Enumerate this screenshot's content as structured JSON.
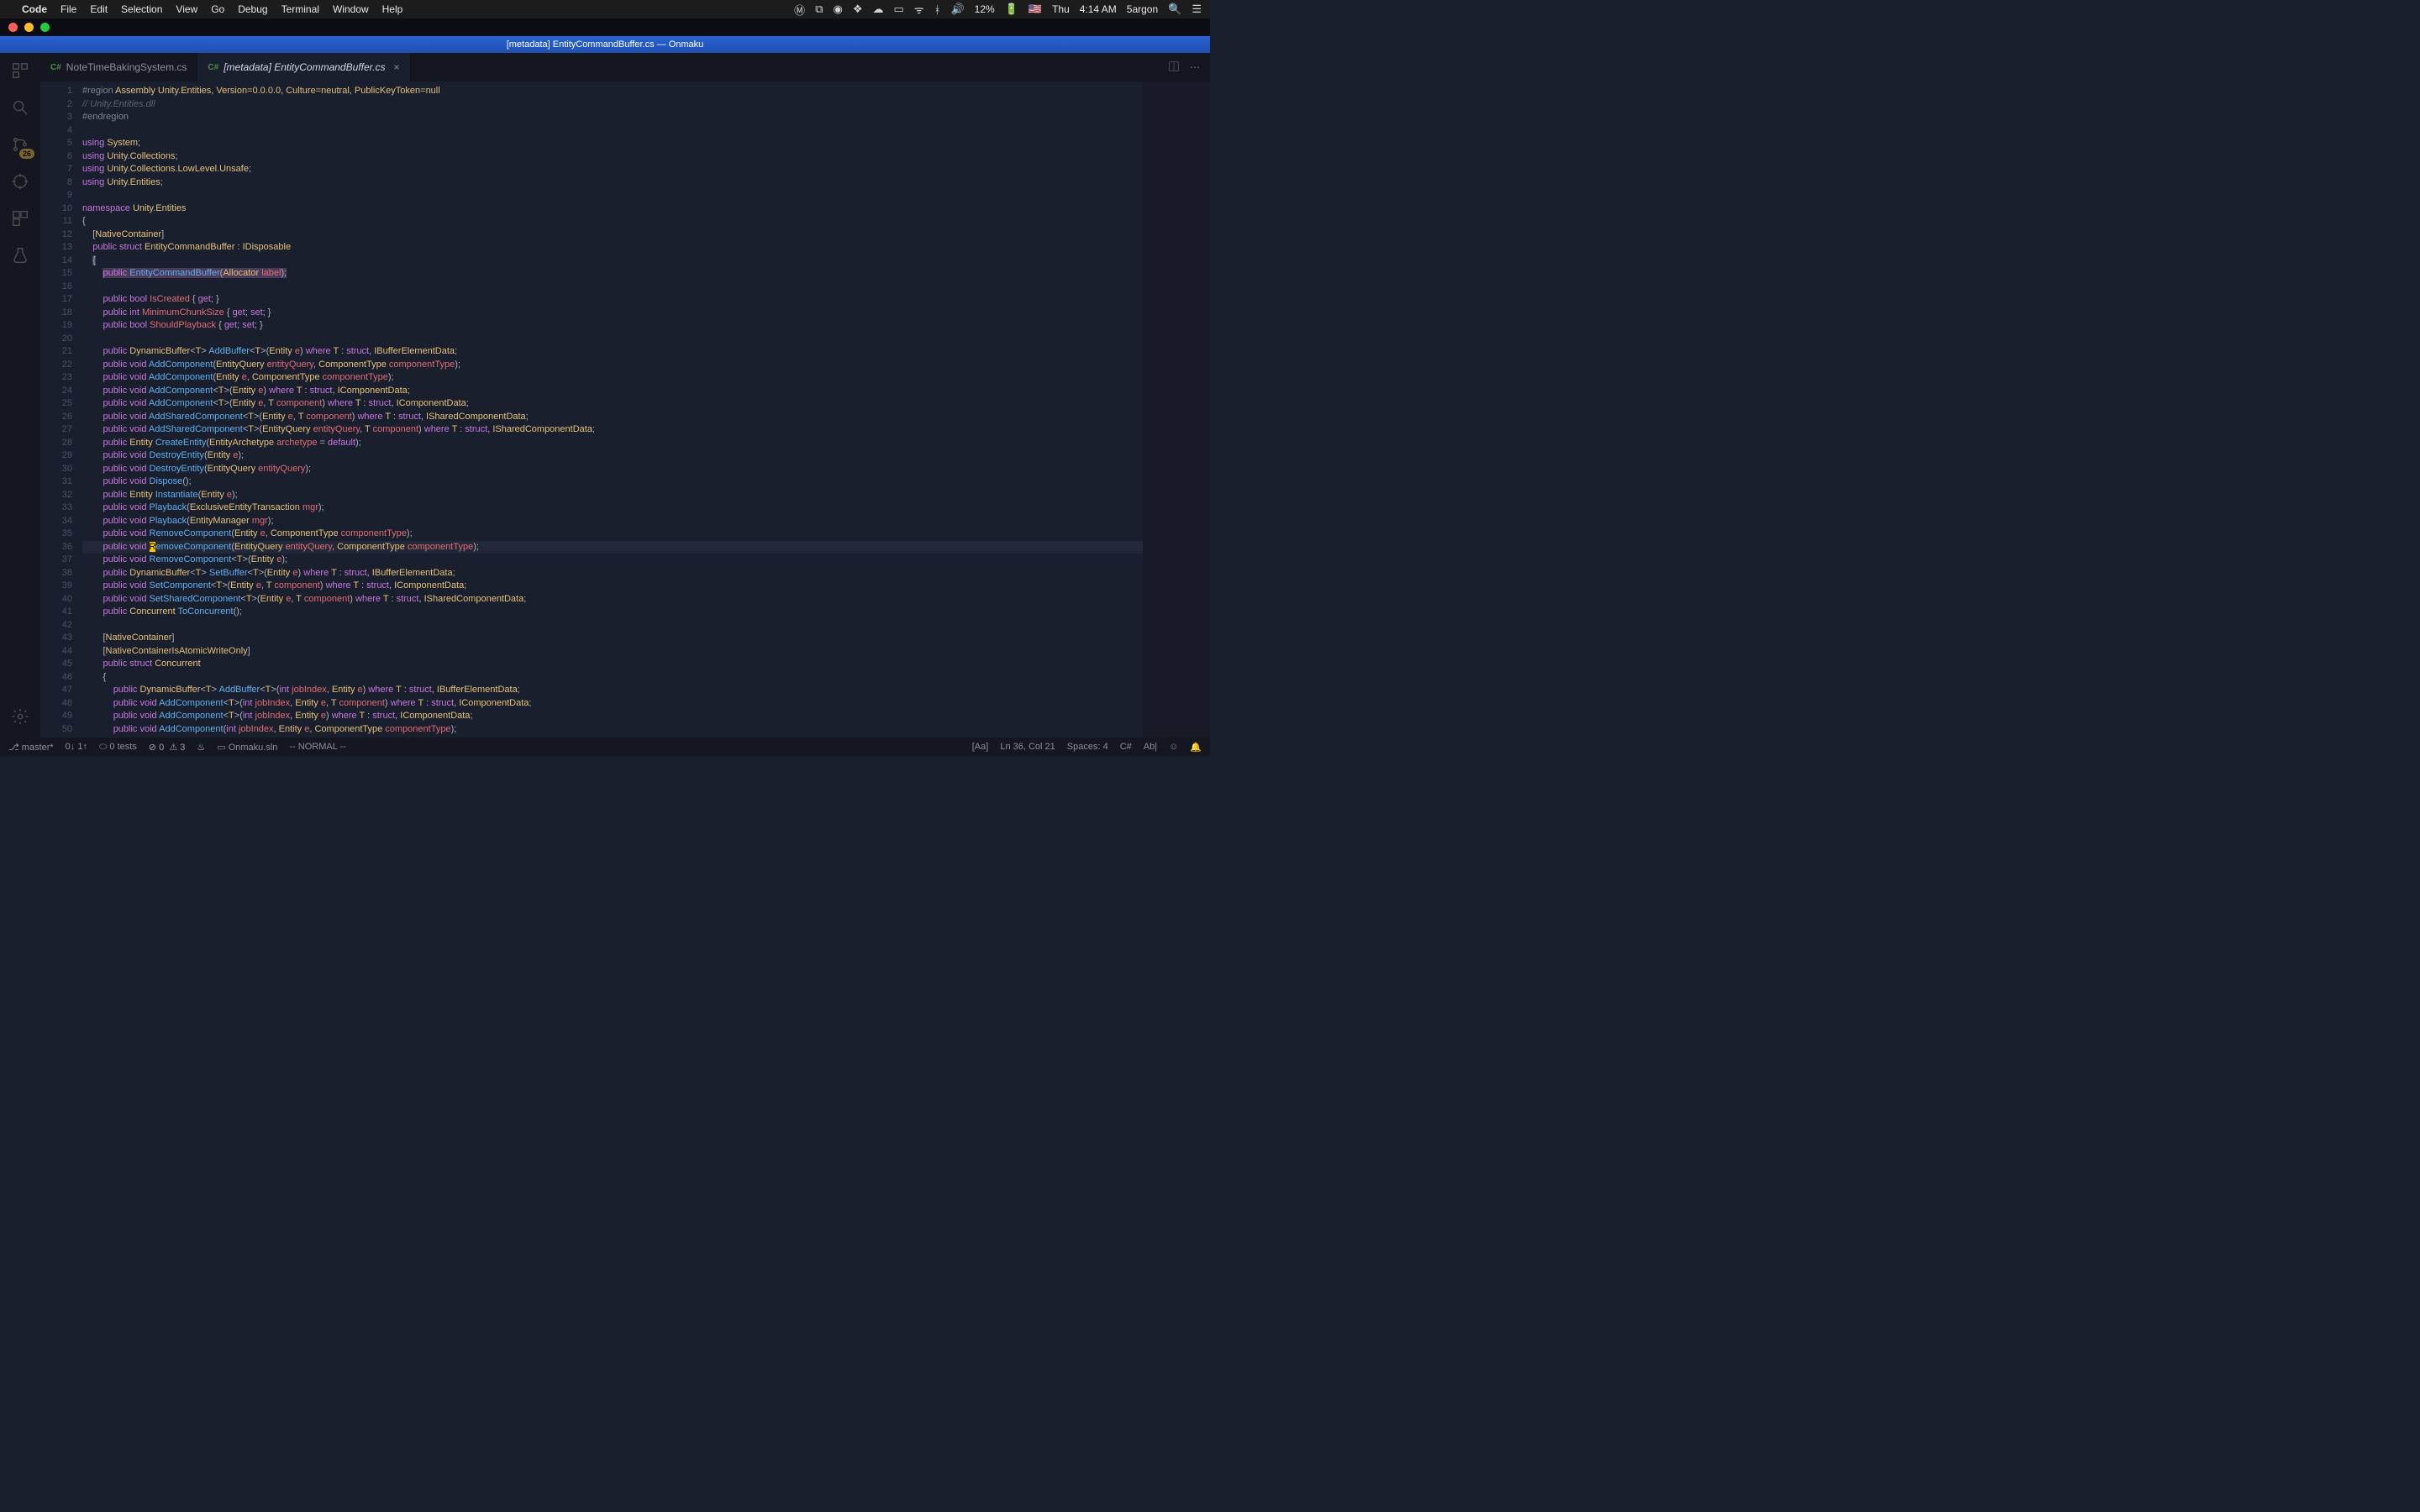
{
  "menubar": {
    "app": "Code",
    "items": [
      "File",
      "Edit",
      "Selection",
      "View",
      "Go",
      "Debug",
      "Terminal",
      "Window",
      "Help"
    ],
    "right": {
      "battery": "12%",
      "day": "Thu",
      "time": "4:14 AM",
      "user": "5argon"
    }
  },
  "window": {
    "title": "[metadata] EntityCommandBuffer.cs — Onmaku"
  },
  "activity": {
    "badge": "26"
  },
  "tabs": {
    "items": [
      {
        "icon": "C#",
        "label": "NoteTimeBakingSystem.cs",
        "active": false,
        "italic": false
      },
      {
        "icon": "C#",
        "label": "[metadata] EntityCommandBuffer.cs",
        "active": true,
        "italic": true
      }
    ]
  },
  "statusbar": {
    "branch": "master*",
    "sync": "0↓ 1↑",
    "tests": "0 tests",
    "errors": "0",
    "warnings": "3",
    "solution": "Onmaku.sln",
    "vim": "-- NORMAL --",
    "pos": "Ln 36, Col 21",
    "spaces": "Spaces: 4",
    "lang": "C#",
    "enc": "Ab|"
  },
  "code": {
    "lines": [
      {
        "n": 1,
        "html": "<span class='region'>#region</span> <span class='type'>Assembly Unity.Entities, Version=0.0.0.0, Culture=neutral, PublicKeyToken=null</span>"
      },
      {
        "n": 2,
        "html": "<span class='comment'>// Unity.Entities.dll</span>"
      },
      {
        "n": 3,
        "html": "<span class='region'>#endregion</span>"
      },
      {
        "n": 4,
        "html": ""
      },
      {
        "n": 5,
        "html": "<span class='kw'>using</span> <span class='type'>System</span>;"
      },
      {
        "n": 6,
        "html": "<span class='kw'>using</span> <span class='type'>Unity</span>.<span class='type'>Collections</span>;"
      },
      {
        "n": 7,
        "html": "<span class='kw'>using</span> <span class='type'>Unity</span>.<span class='type'>Collections</span>.<span class='type'>LowLevel</span>.<span class='type'>Unsafe</span>;"
      },
      {
        "n": 8,
        "html": "<span class='kw'>using</span> <span class='type'>Unity</span>.<span class='type'>Entities</span>;"
      },
      {
        "n": 9,
        "html": ""
      },
      {
        "n": 10,
        "html": "<span class='kw'>namespace</span> <span class='type'>Unity</span>.<span class='type'>Entities</span>"
      },
      {
        "n": 11,
        "html": "{"
      },
      {
        "n": 12,
        "html": "    [<span class='type'>NativeContainer</span>]"
      },
      {
        "n": 13,
        "html": "    <span class='kw'>public</span> <span class='kw'>struct</span> <span class='type'>EntityCommandBuffer</span> : <span class='type'>IDisposable</span>"
      },
      {
        "n": 14,
        "html": "    <span class='hl'>{</span>"
      },
      {
        "n": 15,
        "html": "        <span class='sel'><span class='kw'>public</span> <span class='method'>EntityCommandBuffer</span>(<span class='type'>Allocator</span> <span class='var'>label</span>);</span>"
      },
      {
        "n": 16,
        "html": ""
      },
      {
        "n": 17,
        "html": "        <span class='kw'>public</span> <span class='kw'>bool</span> <span class='var'>IsCreated</span> { <span class='kw'>get</span>; }"
      },
      {
        "n": 18,
        "html": "        <span class='kw'>public</span> <span class='kw'>int</span> <span class='var'>MinimumChunkSize</span> { <span class='kw'>get</span>; <span class='kw'>set</span>; }"
      },
      {
        "n": 19,
        "html": "        <span class='kw'>public</span> <span class='kw'>bool</span> <span class='var'>ShouldPlayback</span> { <span class='kw'>get</span>; <span class='kw'>set</span>; }"
      },
      {
        "n": 20,
        "html": ""
      },
      {
        "n": 21,
        "html": "        <span class='kw'>public</span> <span class='type'>DynamicBuffer</span>&lt;<span class='type'>T</span>&gt; <span class='method'>AddBuffer</span>&lt;<span class='type'>T</span>&gt;(<span class='type'>Entity</span> <span class='var'>e</span>) <span class='kw'>where</span> <span class='type'>T</span> : <span class='kw'>struct</span>, <span class='type'>IBufferElementData</span>;"
      },
      {
        "n": 22,
        "html": "        <span class='kw'>public</span> <span class='kw'>void</span> <span class='method'>AddComponent</span>(<span class='type'>EntityQuery</span> <span class='var'>entityQuery</span>, <span class='type'>ComponentType</span> <span class='var'>componentType</span>);"
      },
      {
        "n": 23,
        "html": "        <span class='kw'>public</span> <span class='kw'>void</span> <span class='method'>AddComponent</span>(<span class='type'>Entity</span> <span class='var'>e</span>, <span class='type'>ComponentType</span> <span class='var'>componentType</span>);"
      },
      {
        "n": 24,
        "html": "        <span class='kw'>public</span> <span class='kw'>void</span> <span class='method'>AddComponent</span>&lt;<span class='type'>T</span>&gt;(<span class='type'>Entity</span> <span class='var'>e</span>) <span class='kw'>where</span> <span class='type'>T</span> : <span class='kw'>struct</span>, <span class='type'>IComponentData</span>;"
      },
      {
        "n": 25,
        "html": "        <span class='kw'>public</span> <span class='kw'>void</span> <span class='method'>AddComponent</span>&lt;<span class='type'>T</span>&gt;(<span class='type'>Entity</span> <span class='var'>e</span>, <span class='type'>T</span> <span class='var'>component</span>) <span class='kw'>where</span> <span class='type'>T</span> : <span class='kw'>struct</span>, <span class='type'>IComponentData</span>;"
      },
      {
        "n": 26,
        "html": "        <span class='kw'>public</span> <span class='kw'>void</span> <span class='method'>AddSharedComponent</span>&lt;<span class='type'>T</span>&gt;(<span class='type'>Entity</span> <span class='var'>e</span>, <span class='type'>T</span> <span class='var'>component</span>) <span class='kw'>where</span> <span class='type'>T</span> : <span class='kw'>struct</span>, <span class='type'>ISharedComponentData</span>;"
      },
      {
        "n": 27,
        "html": "        <span class='kw'>public</span> <span class='kw'>void</span> <span class='method'>AddSharedComponent</span>&lt;<span class='type'>T</span>&gt;(<span class='type'>EntityQuery</span> <span class='var'>entityQuery</span>, <span class='type'>T</span> <span class='var'>component</span>) <span class='kw'>where</span> <span class='type'>T</span> : <span class='kw'>struct</span>, <span class='type'>ISharedComponentData</span>;"
      },
      {
        "n": 28,
        "html": "        <span class='kw'>public</span> <span class='type'>Entity</span> <span class='method'>CreateEntity</span>(<span class='type'>EntityArchetype</span> <span class='var'>archetype</span> = <span class='kw'>default</span>);"
      },
      {
        "n": 29,
        "html": "        <span class='kw'>public</span> <span class='kw'>void</span> <span class='method'>DestroyEntity</span>(<span class='type'>Entity</span> <span class='var'>e</span>);"
      },
      {
        "n": 30,
        "html": "        <span class='kw'>public</span> <span class='kw'>void</span> <span class='method'>DestroyEntity</span>(<span class='type'>EntityQuery</span> <span class='var'>entityQuery</span>);"
      },
      {
        "n": 31,
        "html": "        <span class='kw'>public</span> <span class='kw'>void</span> <span class='method'>Dispose</span>();"
      },
      {
        "n": 32,
        "html": "        <span class='kw'>public</span> <span class='type'>Entity</span> <span class='method'>Instantiate</span>(<span class='type'>Entity</span> <span class='var'>e</span>);"
      },
      {
        "n": 33,
        "html": "        <span class='kw'>public</span> <span class='kw'>void</span> <span class='method'>Playback</span>(<span class='type'>ExclusiveEntityTransaction</span> <span class='var'>mgr</span>);"
      },
      {
        "n": 34,
        "html": "        <span class='kw'>public</span> <span class='kw'>void</span> <span class='method'>Playback</span>(<span class='type'>EntityManager</span> <span class='var'>mgr</span>);"
      },
      {
        "n": 35,
        "html": "        <span class='kw'>public</span> <span class='kw'>void</span> <span class='method'>RemoveComponent</span>(<span class='type'>Entity</span> <span class='var'>e</span>, <span class='type'>ComponentType</span> <span class='var'>componentType</span>);"
      },
      {
        "n": 36,
        "current": true,
        "html": "        <span class='kw'>public</span> <span class='kw'>void</span> <span class='cursor'>R</span><span class='method'>emoveComponent</span>(<span class='type'>EntityQuery</span> <span class='var'>entityQuery</span>, <span class='type'>ComponentType</span> <span class='var'>componentType</span>);"
      },
      {
        "n": 37,
        "html": "        <span class='kw'>public</span> <span class='kw'>void</span> <span class='method'>RemoveComponent</span>&lt;<span class='type'>T</span>&gt;(<span class='type'>Entity</span> <span class='var'>e</span>);"
      },
      {
        "n": 38,
        "html": "        <span class='kw'>public</span> <span class='type'>DynamicBuffer</span>&lt;<span class='type'>T</span>&gt; <span class='method'>SetBuffer</span>&lt;<span class='type'>T</span>&gt;(<span class='type'>Entity</span> <span class='var'>e</span>) <span class='kw'>where</span> <span class='type'>T</span> : <span class='kw'>struct</span>, <span class='type'>IBufferElementData</span>;"
      },
      {
        "n": 39,
        "html": "        <span class='kw'>public</span> <span class='kw'>void</span> <span class='method'>SetComponent</span>&lt;<span class='type'>T</span>&gt;(<span class='type'>Entity</span> <span class='var'>e</span>, <span class='type'>T</span> <span class='var'>component</span>) <span class='kw'>where</span> <span class='type'>T</span> : <span class='kw'>struct</span>, <span class='type'>IComponentData</span>;"
      },
      {
        "n": 40,
        "html": "        <span class='kw'>public</span> <span class='kw'>void</span> <span class='method'>SetSharedComponent</span>&lt;<span class='type'>T</span>&gt;(<span class='type'>Entity</span> <span class='var'>e</span>, <span class='type'>T</span> <span class='var'>component</span>) <span class='kw'>where</span> <span class='type'>T</span> : <span class='kw'>struct</span>, <span class='type'>ISharedComponentData</span>;"
      },
      {
        "n": 41,
        "html": "        <span class='kw'>public</span> <span class='type'>Concurrent</span> <span class='method'>ToConcurrent</span>();"
      },
      {
        "n": 42,
        "html": ""
      },
      {
        "n": 43,
        "html": "        [<span class='type'>NativeContainer</span>]"
      },
      {
        "n": 44,
        "html": "        [<span class='type'>NativeContainerIsAtomicWriteOnly</span>]"
      },
      {
        "n": 45,
        "html": "        <span class='kw'>public</span> <span class='kw'>struct</span> <span class='type'>Concurrent</span>"
      },
      {
        "n": 46,
        "html": "        {"
      },
      {
        "n": 47,
        "html": "            <span class='kw'>public</span> <span class='type'>DynamicBuffer</span>&lt;<span class='type'>T</span>&gt; <span class='method'>AddBuffer</span>&lt;<span class='type'>T</span>&gt;(<span class='kw'>int</span> <span class='var'>jobIndex</span>, <span class='type'>Entity</span> <span class='var'>e</span>) <span class='kw'>where</span> <span class='type'>T</span> : <span class='kw'>struct</span>, <span class='type'>IBufferElementData</span>;"
      },
      {
        "n": 48,
        "html": "            <span class='kw'>public</span> <span class='kw'>void</span> <span class='method'>AddComponent</span>&lt;<span class='type'>T</span>&gt;(<span class='kw'>int</span> <span class='var'>jobIndex</span>, <span class='type'>Entity</span> <span class='var'>e</span>, <span class='type'>T</span> <span class='var'>component</span>) <span class='kw'>where</span> <span class='type'>T</span> : <span class='kw'>struct</span>, <span class='type'>IComponentData</span>;"
      },
      {
        "n": 49,
        "html": "            <span class='kw'>public</span> <span class='kw'>void</span> <span class='method'>AddComponent</span>&lt;<span class='type'>T</span>&gt;(<span class='kw'>int</span> <span class='var'>jobIndex</span>, <span class='type'>Entity</span> <span class='var'>e</span>) <span class='kw'>where</span> <span class='type'>T</span> : <span class='kw'>struct</span>, <span class='type'>IComponentData</span>;"
      },
      {
        "n": 50,
        "html": "            <span class='kw'>public</span> <span class='kw'>void</span> <span class='method'>AddComponent</span>(<span class='kw'>int</span> <span class='var'>jobIndex</span>, <span class='type'>Entity</span> <span class='var'>e</span>, <span class='type'>ComponentType</span> <span class='var'>componentType</span>);"
      }
    ]
  }
}
